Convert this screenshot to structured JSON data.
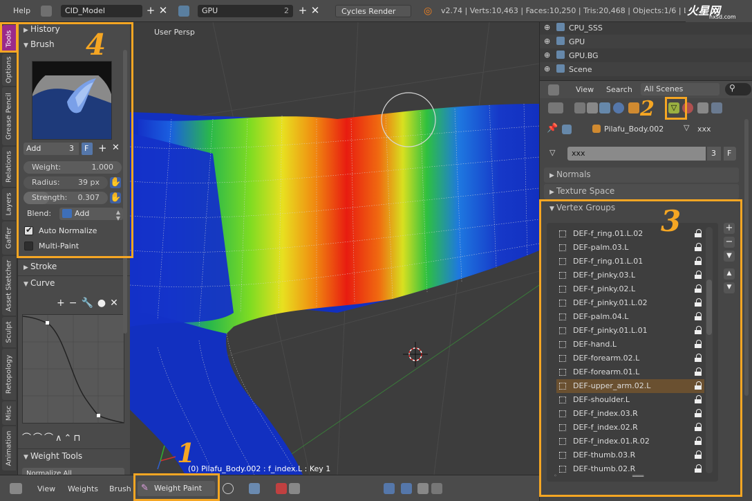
{
  "topbar": {
    "help": "Help",
    "screen_name": "CID_Model",
    "scene_name": "GPU",
    "scene_users": "2",
    "render_engine": "Cycles Render",
    "stats": "v2.74 | Verts:10,463 | Faces:10,250 | Tris:20,468 | Objects:1/6 | Lar",
    "watermark": "火星网",
    "watermark_sub": "hxsd.com"
  },
  "tabs": [
    "Tools",
    "Options",
    "Grease Pencil",
    "Relations",
    "Layers",
    "Gaffer",
    "Asset Sketcher",
    "Sculpt",
    "Retopology",
    "Misc",
    "Animation"
  ],
  "tool_panel": {
    "history": "History",
    "brush": "Brush",
    "brush_name": "Add",
    "brush_users": "3",
    "brush_fake": "F",
    "weight_label": "Weight:",
    "weight_value": "1.000",
    "weight_level": 1.0,
    "radius_label": "Radius:",
    "radius_value": "39 px",
    "strength_label": "Strength:",
    "strength_value": "0.307",
    "strength_level": 0.307,
    "blend_label": "Blend:",
    "blend_value": "Add",
    "auto_normalize": "Auto Normalize",
    "multi_paint": "Multi-Paint",
    "stroke": "Stroke",
    "curve": "Curve",
    "weight_tools": "Weight Tools",
    "normalize_all": "Normalize All"
  },
  "viewport": {
    "view_label": "User Persp",
    "status": "(0) Pilafu_Body.002 : f_index.L : Key 1"
  },
  "bottombar": {
    "view": "View",
    "weights": "Weights",
    "brush": "Brush",
    "mode": "Weight Paint"
  },
  "outliner": {
    "items": [
      "CPU_SSS",
      "GPU",
      "GPU.BG",
      "Scene"
    ],
    "view": "View",
    "search": "Search",
    "filter": "All Scenes"
  },
  "properties": {
    "object_name": "Pilafu_Body.002",
    "mesh_name": "xxx",
    "datablock_name": "xxx",
    "datablock_users": "3",
    "datablock_fake": "F",
    "normals": "Normals",
    "texture_space": "Texture Space",
    "vertex_groups": "Vertex Groups",
    "groups": [
      "DEF-f_ring.01.L.02",
      "DEF-palm.03.L",
      "DEF-f_ring.01.L.01",
      "DEF-f_pinky.03.L",
      "DEF-f_pinky.02.L",
      "DEF-f_pinky.01.L.02",
      "DEF-palm.04.L",
      "DEF-f_pinky.01.L.01",
      "DEF-hand.L",
      "DEF-forearm.02.L",
      "DEF-forearm.01.L",
      "DEF-upper_arm.02.L",
      "DEF-shoulder.L",
      "DEF-f_index.03.R",
      "DEF-f_index.02.R",
      "DEF-f_index.01.R.02",
      "DEF-thumb.03.R",
      "DEF-thumb.02.R"
    ],
    "selected_group": "DEF-upper_arm.02.L"
  },
  "annotations": [
    "1",
    "2",
    "3",
    "4"
  ],
  "colors": {
    "accent": "#f5a623",
    "tab_active": "#9a2a8a",
    "selection": "#6a5030"
  }
}
